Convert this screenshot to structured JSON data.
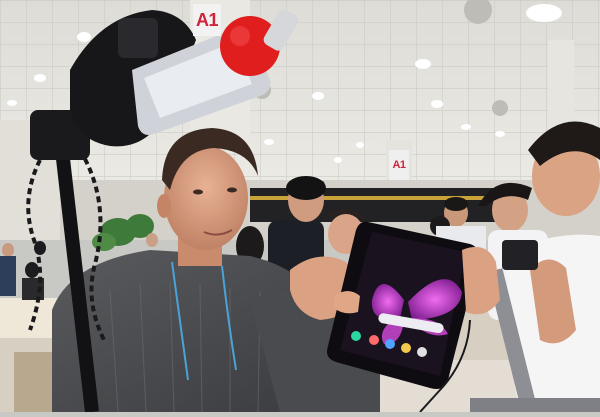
{
  "scene": {
    "sign_main": "A1",
    "sign_far": "A1"
  },
  "colors": {
    "ceiling": "#e3e2dc",
    "sweater": "#4c4d50",
    "phone_screen": "#151018",
    "butterfly": "#c43ccf",
    "mic": "#e01e1e"
  }
}
